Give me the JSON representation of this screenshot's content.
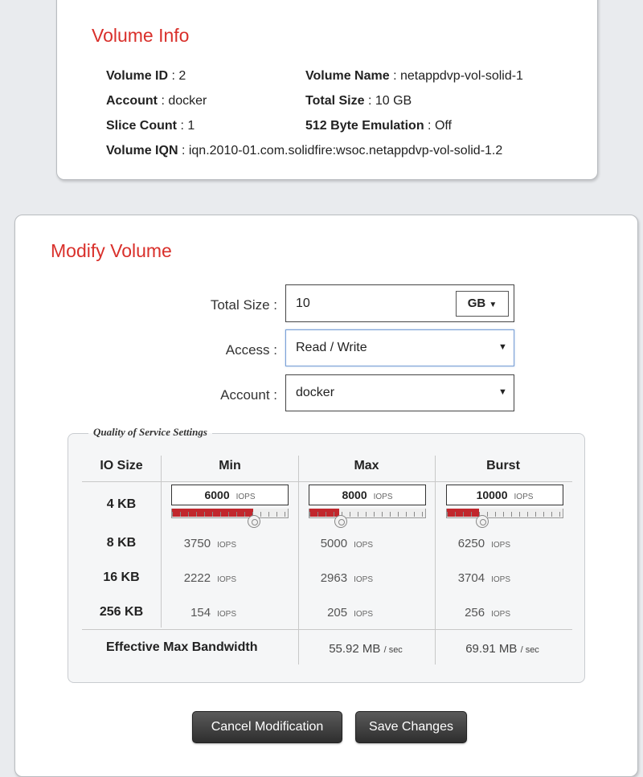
{
  "volume_info": {
    "title": "Volume Info",
    "volume_id_label": "Volume ID",
    "volume_id": "2",
    "volume_name_label": "Volume Name",
    "volume_name": "netappdvp-vol-solid-1",
    "account_label": "Account",
    "account": "docker",
    "total_size_label": "Total Size",
    "total_size": "10 GB",
    "slice_count_label": "Slice Count",
    "slice_count": "1",
    "emulation_label": "512 Byte Emulation",
    "emulation": "Off",
    "iqn_label": "Volume IQN",
    "iqn": "iqn.2010-01.com.solidfire:wsoc.netappdvp-vol-solid-1.2",
    "separator": " : "
  },
  "modify": {
    "title": "Modify Volume",
    "total_size_label": "Total Size :",
    "total_size_value": "10",
    "unit": "GB",
    "access_label": "Access :",
    "access_value": "Read / Write",
    "account_label": "Account :",
    "account_value": "docker"
  },
  "qos": {
    "legend": "Quality of Service Settings",
    "headers": {
      "io_size": "IO Size",
      "min": "Min",
      "max": "Max",
      "burst": "Burst"
    },
    "iops_unit": "IOPS",
    "rows": [
      {
        "size": "4 KB",
        "min": "6000",
        "max": "8000",
        "burst": "10000"
      },
      {
        "size": "8 KB",
        "min": "3750",
        "max": "5000",
        "burst": "6250"
      },
      {
        "size": "16 KB",
        "min": "2222",
        "max": "2963",
        "burst": "3704"
      },
      {
        "size": "256 KB",
        "min": "154",
        "max": "205",
        "burst": "256"
      }
    ],
    "slider_fill": {
      "min": 0.7,
      "max": 0.26,
      "burst": 0.28
    },
    "bandwidth_label": "Effective Max Bandwidth",
    "bandwidth_max": "55.92 MB",
    "bandwidth_burst": "69.91 MB",
    "bandwidth_unit": "/ sec"
  },
  "buttons": {
    "cancel": "Cancel Modification",
    "save": "Save Changes"
  },
  "colors": {
    "accent": "#d9302b",
    "slider_fill": "#c1272d"
  }
}
